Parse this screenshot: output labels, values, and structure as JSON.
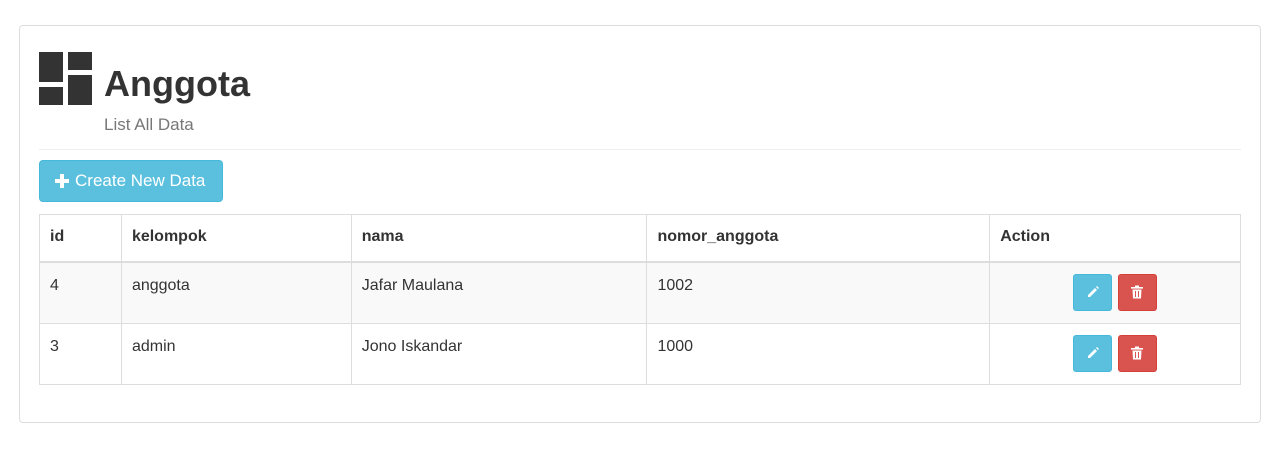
{
  "header": {
    "title": "Anggota",
    "subtitle": "List All Data",
    "icon": "dashboard-icon"
  },
  "toolbar": {
    "create_label": "Create New Data",
    "create_icon": "plus-icon",
    "create_color": "#5bc0de"
  },
  "table": {
    "columns": [
      "id",
      "kelompok",
      "nama",
      "nomor_anggota",
      "Action"
    ],
    "rows": [
      {
        "id": "4",
        "kelompok": "anggota",
        "nama": "Jafar Maulana",
        "nomor_anggota": "1002"
      },
      {
        "id": "3",
        "kelompok": "admin",
        "nama": "Jono Iskandar",
        "nomor_anggota": "1000"
      }
    ],
    "edit_icon": "pencil-icon",
    "delete_icon": "trash-icon",
    "edit_color": "#5bc0de",
    "delete_color": "#d9534f"
  }
}
